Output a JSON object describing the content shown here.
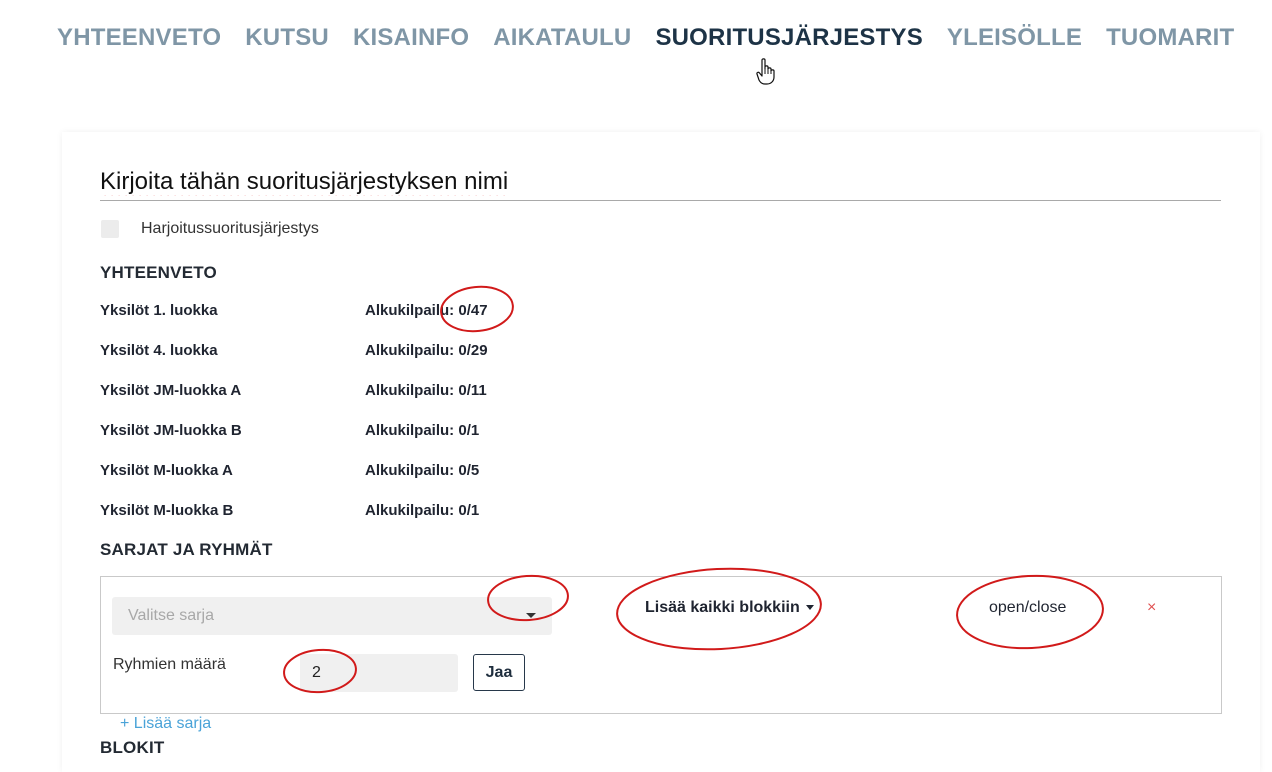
{
  "nav": {
    "tabs": [
      {
        "label": "YHTEENVETO"
      },
      {
        "label": "KUTSU"
      },
      {
        "label": "KISAINFO"
      },
      {
        "label": "AIKATAULU"
      },
      {
        "label": "SUORITUSJÄRJESTYS",
        "active": true
      },
      {
        "label": "YLEISÖLLE"
      },
      {
        "label": "TUOMARIT"
      }
    ]
  },
  "form": {
    "title_value": "Kirjoita tähän suoritusjärjestyksen nimi",
    "practice_checkbox_label": "Harjoitussuoritusjärjestys"
  },
  "summary": {
    "title": "YHTEENVETO",
    "rows": [
      {
        "name": "Yksilöt 1. luokka",
        "value": "Alkukilpailu: 0/47"
      },
      {
        "name": "Yksilöt 4. luokka",
        "value": "Alkukilpailu: 0/29"
      },
      {
        "name": "Yksilöt JM-luokka A",
        "value": "Alkukilpailu: 0/11"
      },
      {
        "name": "Yksilöt JM-luokka B",
        "value": "Alkukilpailu: 0/1"
      },
      {
        "name": "Yksilöt M-luokka A",
        "value": "Alkukilpailu: 0/5"
      },
      {
        "name": "Yksilöt M-luokka B",
        "value": "Alkukilpailu: 0/1"
      }
    ]
  },
  "series": {
    "title": "SARJAT JA RYHMÄT",
    "select_placeholder": "Valitse sarja",
    "add_all_button": "Lisää kaikki blokkiin",
    "open_close_label": "open/close",
    "remove_icon": "×",
    "groups_label": "Ryhmien määrä",
    "groups_value": "2",
    "split_button": "Jaa",
    "add_series_link": "+ Lisää sarja"
  },
  "blocks": {
    "title": "BLOKIT"
  },
  "colors": {
    "nav_inactive": "#7f96a6",
    "nav_active": "#1d3346",
    "annotation": "#d11a1a",
    "link": "#4aa3d8",
    "remove": "#e05050"
  }
}
